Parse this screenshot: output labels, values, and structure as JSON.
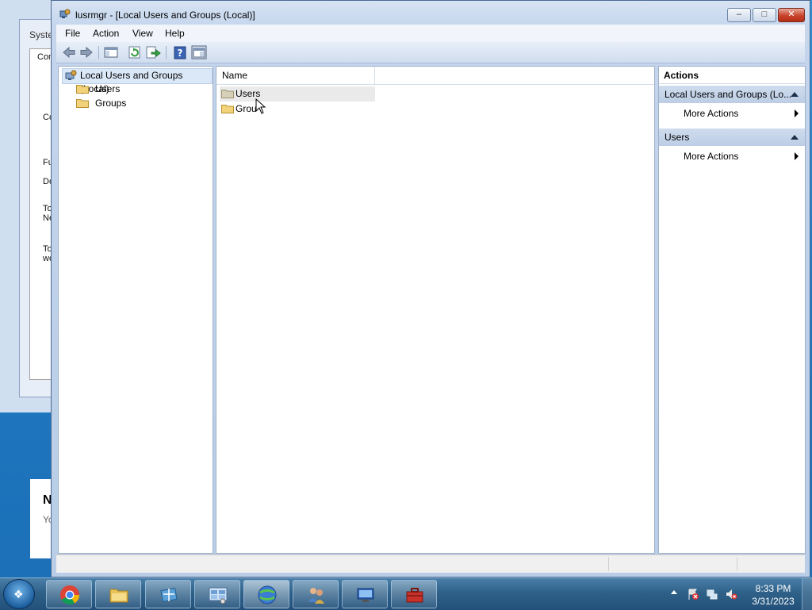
{
  "window": {
    "title": "lusrmgr - [Local Users and Groups (Local)]",
    "buttons": {
      "minimize": "–",
      "maximize": "□",
      "close": "✕"
    }
  },
  "menu": [
    "File",
    "Action",
    "View",
    "Help"
  ],
  "toolbar": {
    "icons": [
      "back-arrow-icon",
      "forward-arrow-icon",
      "show-hide-console-tree-icon",
      "refresh-icon",
      "export-list-icon",
      "help-icon",
      "show-hide-action-pane-icon"
    ]
  },
  "tree": {
    "root": "Local Users and Groups (Local)",
    "items": [
      "Users",
      "Groups"
    ]
  },
  "list": {
    "column_name": "Name",
    "rows": [
      "Users",
      "Grou"
    ]
  },
  "actions": {
    "title": "Actions",
    "sections": [
      {
        "header": "Local Users and Groups (Lo...",
        "item": "More Actions"
      },
      {
        "header": "Users",
        "item": "More Actions"
      }
    ]
  },
  "background": {
    "window_title": "Syste",
    "tab": "Com",
    "labels": [
      "Co",
      "Fu",
      "Do",
      "To",
      "Ne",
      "To",
      "wo"
    ],
    "card_bold": "N",
    "card_text": "Yo"
  },
  "taskbar": {
    "apps": [
      "chrome-icon",
      "file-explorer-icon",
      "network-icon",
      "control-panel-icon",
      "internet-download-manager-icon",
      "users-icon",
      "remote-desktop-icon",
      "toolbox-icon"
    ],
    "time": "8:33 PM",
    "date": "3/31/2023"
  },
  "colors": {
    "accent": "#2f6188",
    "selection": "#dbe8f7",
    "pane_border": "#9eb1c9"
  }
}
